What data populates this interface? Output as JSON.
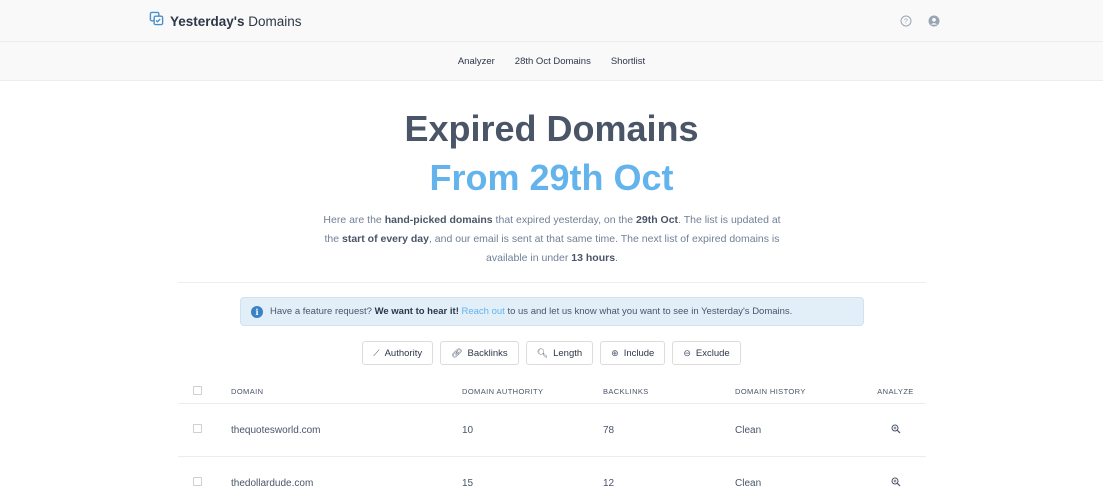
{
  "header": {
    "logo_bold": "Yesterday's",
    "logo_rest": "Domains",
    "icons": [
      "help-icon",
      "user-icon"
    ]
  },
  "nav": {
    "items": [
      "Analyzer",
      "28th Oct Domains",
      "Shortlist"
    ]
  },
  "hero": {
    "title_line1": "Expired Domains",
    "title_line2": "From 29th Oct",
    "intro_p1": "Here are the ",
    "intro_b1": "hand-picked domains",
    "intro_p2": " that expired yesterday, on the ",
    "intro_b2": "29th Oct",
    "intro_p3": ". The list is updated at the ",
    "intro_b3": "start of every day",
    "intro_p4": ", and our email is sent at that same time. The next list of expired domains is available in under ",
    "intro_b4": "13 hours",
    "intro_p5": "."
  },
  "notice": {
    "icon": "info-icon",
    "text_a": "Have a feature request?",
    "text_b": "We want to hear it!",
    "link": "Reach out",
    "text_c": "to us and let us know what you want to see in Yesterday's Domains."
  },
  "filters": [
    {
      "label": "Authority",
      "icon": "chart-line-icon"
    },
    {
      "label": "Backlinks",
      "icon": "link-icon"
    },
    {
      "label": "Length",
      "icon": "search-icon"
    },
    {
      "label": "Include",
      "icon": "plus-circle-icon"
    },
    {
      "label": "Exclude",
      "icon": "minus-circle-icon"
    }
  ],
  "table": {
    "columns": [
      "DOMAIN",
      "DOMAIN AUTHORITY",
      "BACKLINKS",
      "DOMAIN HISTORY",
      "ANALYZE"
    ],
    "rows": [
      {
        "domain": "thequotesworld.com",
        "authority": "10",
        "backlinks": "78",
        "history": "Clean"
      },
      {
        "domain": "thedollardude.com",
        "authority": "15",
        "backlinks": "12",
        "history": "Clean"
      }
    ]
  },
  "colors": {
    "accent": "#63b3ed",
    "highlight": "#bfdff7",
    "notice_bg": "#e2eff9",
    "text": "#4a5568"
  }
}
